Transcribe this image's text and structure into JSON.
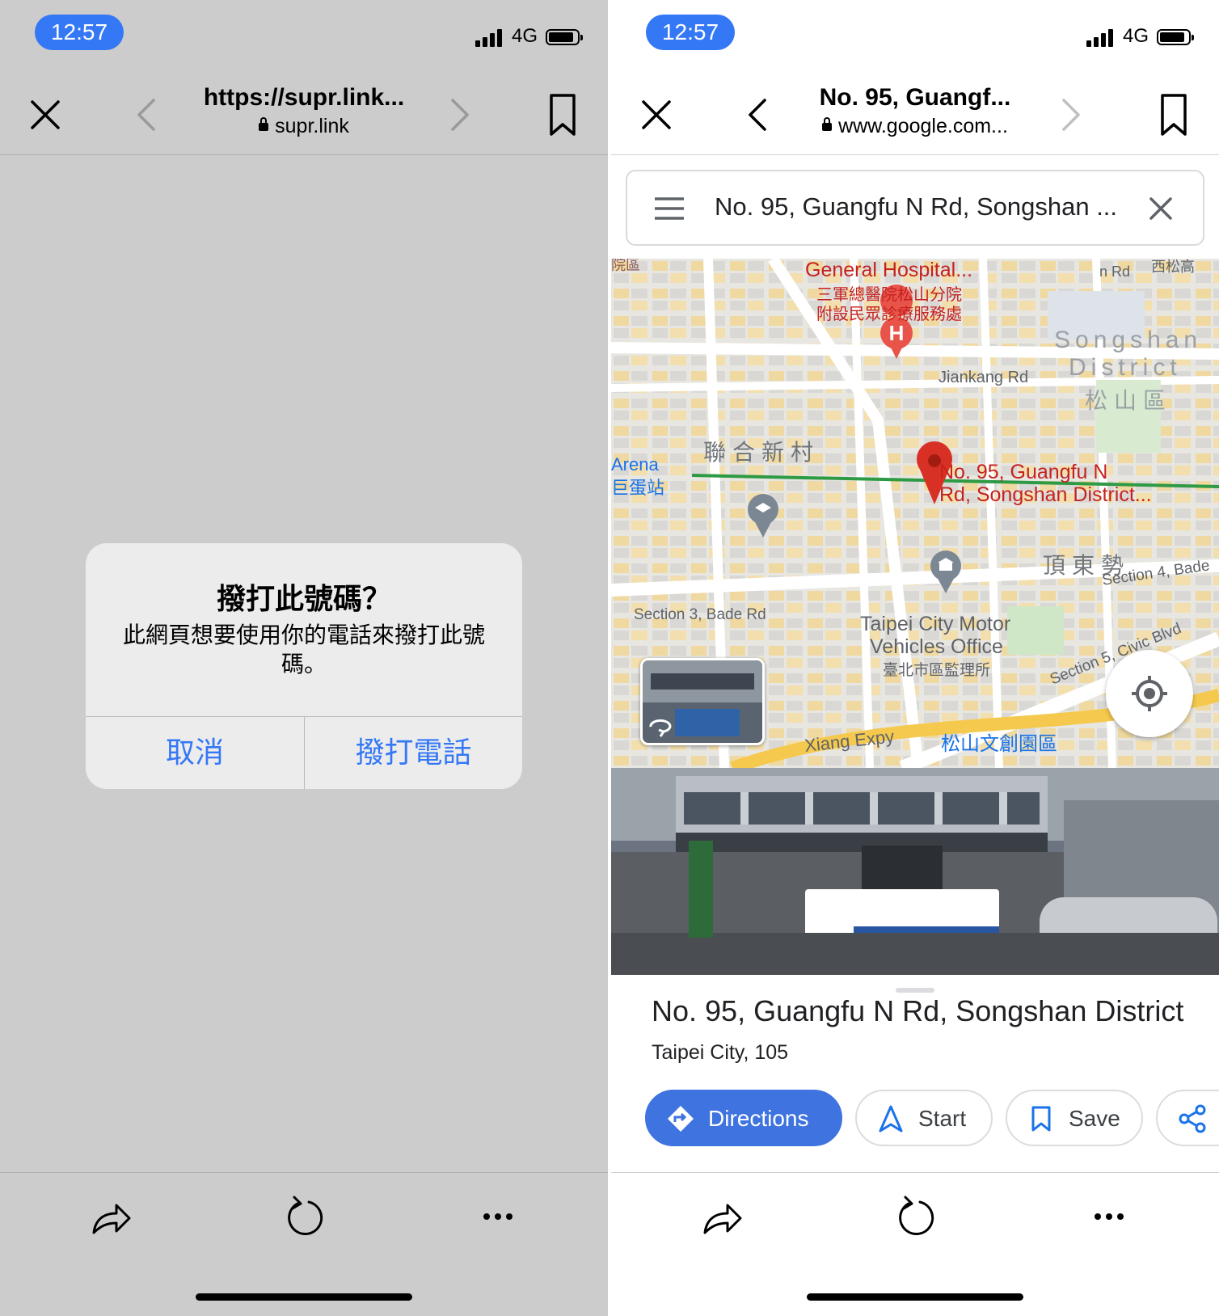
{
  "left": {
    "status": {
      "time": "12:57",
      "network": "4G"
    },
    "nav": {
      "title": "https://supr.link...",
      "domain": "supr.link"
    },
    "alert": {
      "title": "撥打此號碼？",
      "message": "此網頁想要使用你的電話來撥打此號碼。",
      "cancel": "取消",
      "call": "撥打電話"
    }
  },
  "right": {
    "status": {
      "time": "12:57",
      "network": "4G"
    },
    "nav": {
      "title": "No. 95, Guangf...",
      "domain": "www.google.com..."
    },
    "search": {
      "value": "No. 95, Guangfu N Rd, Songshan ..."
    },
    "map": {
      "hospital": "General Hospital...",
      "hospital_zh_1": "三軍總醫院松山分院",
      "hospital_zh_2": "附設民眾診療服務處",
      "jiankang": "Jiankang Rd",
      "district_en_1": "Songshan",
      "district_en_2": "District",
      "district_zh": "松山區",
      "village": "聯合新村",
      "arena": "Arena",
      "arena_zh": "巨蛋站",
      "pin_1": "No. 95, Guangfu N",
      "pin_2": "Rd, Songshan District...",
      "dingdong": "頂東勢",
      "bade4": "Section 4, Bade",
      "bade3": "Section 3, Bade Rd",
      "civic5": "Section 5, Civic Blvd",
      "motor_1": "Taipei City Motor",
      "motor_2": "Vehicles Office",
      "motor_zh": "臺北市區監理所",
      "park": "松山文創園區",
      "expy": "Xiang Expy",
      "top_left": "院區",
      "top_right": "西松高",
      "road_rd": "n Rd"
    },
    "place": {
      "title": "No. 95, Guangfu N Rd, Songshan District",
      "subtitle": "Taipei City, 105"
    },
    "actions": {
      "directions": "Directions",
      "start": "Start",
      "save": "Save"
    }
  },
  "colors": {
    "ios_blue": "#3478f6",
    "maps_blue": "#3f73e0",
    "pin_red": "#d93025",
    "route_green": "#1e8e3e"
  }
}
